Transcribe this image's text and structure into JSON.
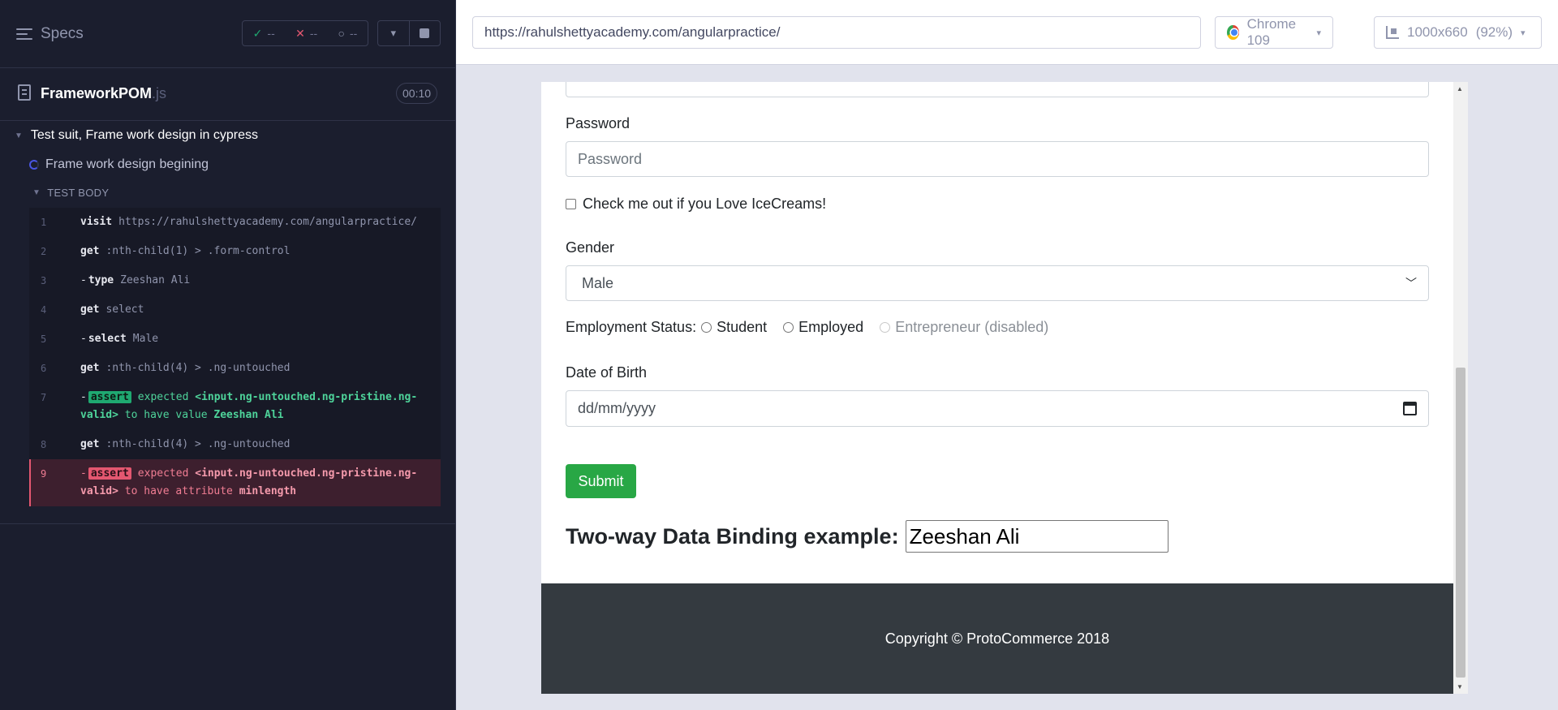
{
  "runner": {
    "specs_label": "Specs",
    "stats": {
      "passed_icon": "check-icon",
      "passed": "--",
      "failed_icon": "x-icon",
      "failed": "--",
      "pending_icon": "spinner-icon",
      "pending": "--"
    },
    "spec_file": {
      "name": "FrameworkPOM",
      "ext": ".js",
      "duration": "00:10"
    },
    "suite_title": "Test suit, Frame work design in cypress",
    "test_title": "Frame work design begining",
    "test_body_label": "TEST BODY",
    "commands": [
      {
        "num": "1",
        "name": "visit",
        "message": "https://rahulshettyacademy.com/angularpractice/"
      },
      {
        "num": "2",
        "name": "get",
        "message": ":nth-child(1) > .form-control"
      },
      {
        "num": "3",
        "name": "type",
        "message": "Zeeshan Ali"
      },
      {
        "num": "4",
        "name": "get",
        "message": "select"
      },
      {
        "num": "5",
        "name": "select",
        "message": "Male"
      },
      {
        "num": "6",
        "name": "get",
        "message": ":nth-child(4) > .ng-untouched"
      },
      {
        "num": "7",
        "name": "assert",
        "p1": "expected",
        "h1": "<input.ng-untouched.ng-pristine.ng-valid>",
        "p2": "to have value",
        "h2": "Zeeshan Ali"
      },
      {
        "num": "8",
        "name": "get",
        "message": ":nth-child(4) > .ng-untouched"
      },
      {
        "num": "9",
        "name": "assert",
        "p1": "expected",
        "h1": "<input.ng-untouched.ng-pristine.ng-valid>",
        "p2": "to have attribute",
        "h2": "minlength"
      }
    ]
  },
  "browser": {
    "url": "https://rahulshettyacademy.com/angularpractice/",
    "browser_name": "Chrome 109",
    "viewport": "1000x660",
    "zoom": "(92%)"
  },
  "form": {
    "password_label": "Password",
    "password_placeholder": "Password",
    "checkbox_label": "Check me out if you Love IceCreams!",
    "gender_label": "Gender",
    "gender_selected": "Male",
    "employment_label": "Employment Status:",
    "employment_options": [
      "Student",
      "Employed",
      "Entrepreneur (disabled)"
    ],
    "dob_label": "Date of Birth",
    "dob_placeholder": "dd/mm/yyyy",
    "submit_label": "Submit",
    "binding_label": "Two-way Data Binding example:",
    "binding_value": "Zeeshan Ali",
    "footer_text": "Copyright © ProtoCommerce 2018"
  },
  "colors": {
    "runner_bg": "#1b1e2e",
    "pass": "#1fa971",
    "fail": "#e45770",
    "submit": "#28a745",
    "footer": "#343a40"
  }
}
